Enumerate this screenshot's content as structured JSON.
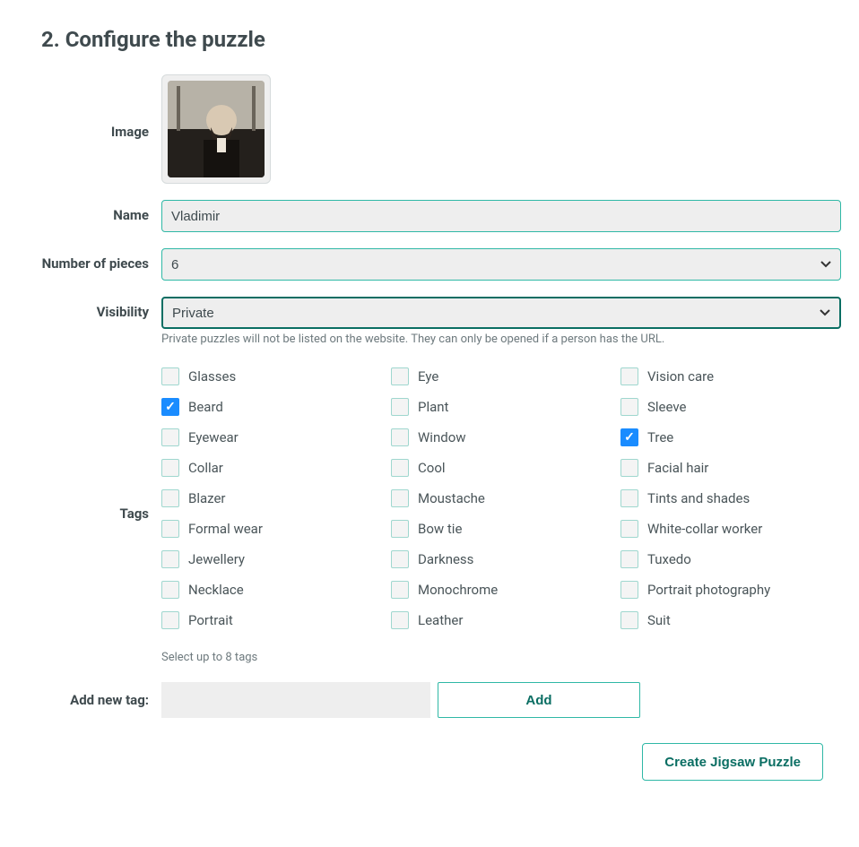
{
  "heading": "2. Configure the puzzle",
  "labels": {
    "image": "Image",
    "name": "Name",
    "pieces": "Number of pieces",
    "visibility": "Visibility",
    "tags": "Tags",
    "addNewTag": "Add new tag:"
  },
  "fields": {
    "name": {
      "value": "Vladimir"
    },
    "pieces": {
      "value": "6"
    },
    "visibility": {
      "value": "Private",
      "help": "Private puzzles will not be listed on the website. They can only be opened if a person has the URL."
    },
    "addTag": {
      "value": ""
    }
  },
  "tags": {
    "items": [
      {
        "label": "Glasses",
        "checked": false
      },
      {
        "label": "Beard",
        "checked": true
      },
      {
        "label": "Eyewear",
        "checked": false
      },
      {
        "label": "Collar",
        "checked": false
      },
      {
        "label": "Blazer",
        "checked": false
      },
      {
        "label": "Formal wear",
        "checked": false
      },
      {
        "label": "Jewellery",
        "checked": false
      },
      {
        "label": "Necklace",
        "checked": false
      },
      {
        "label": "Portrait",
        "checked": false
      },
      {
        "label": "Eye",
        "checked": false
      },
      {
        "label": "Plant",
        "checked": false
      },
      {
        "label": "Window",
        "checked": false
      },
      {
        "label": "Cool",
        "checked": false
      },
      {
        "label": "Moustache",
        "checked": false
      },
      {
        "label": "Bow tie",
        "checked": false
      },
      {
        "label": "Darkness",
        "checked": false
      },
      {
        "label": "Monochrome",
        "checked": false
      },
      {
        "label": "Leather",
        "checked": false
      },
      {
        "label": "Vision care",
        "checked": false
      },
      {
        "label": "Sleeve",
        "checked": false
      },
      {
        "label": "Tree",
        "checked": true
      },
      {
        "label": "Facial hair",
        "checked": false
      },
      {
        "label": "Tints and shades",
        "checked": false
      },
      {
        "label": "White-collar worker",
        "checked": false
      },
      {
        "label": "Tuxedo",
        "checked": false
      },
      {
        "label": "Portrait photography",
        "checked": false
      },
      {
        "label": "Suit",
        "checked": false
      }
    ],
    "help": "Select up to 8 tags"
  },
  "buttons": {
    "add": "Add",
    "create": "Create Jigsaw Puzzle"
  }
}
